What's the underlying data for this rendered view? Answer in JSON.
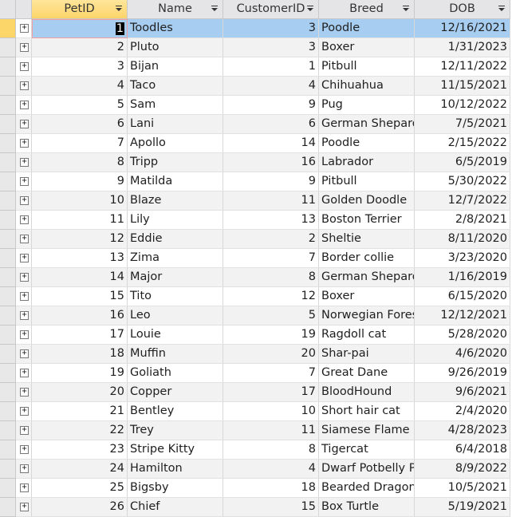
{
  "columns": [
    "PetID",
    "Name",
    "CustomerID",
    "Breed",
    "DOB"
  ],
  "rows": [
    [
      "1",
      "Toodles",
      "3",
      "Poodle",
      "12/16/2021"
    ],
    [
      "2",
      "Pluto",
      "3",
      "Boxer",
      "1/31/2023"
    ],
    [
      "3",
      "Bijan",
      "1",
      "Pitbull",
      "12/11/2022"
    ],
    [
      "4",
      "Taco",
      "4",
      "Chihuahua",
      "11/15/2021"
    ],
    [
      "5",
      "Sam",
      "9",
      "Pug",
      "10/12/2022"
    ],
    [
      "6",
      "Lani",
      "6",
      "German Shepard",
      "7/5/2021"
    ],
    [
      "7",
      "Apollo",
      "14",
      "Poodle",
      "2/15/2022"
    ],
    [
      "8",
      "Tripp",
      "16",
      "Labrador",
      "6/5/2019"
    ],
    [
      "9",
      "Matilda",
      "9",
      "Pitbull",
      "5/30/2022"
    ],
    [
      "10",
      "Blaze",
      "11",
      "Golden Doodle",
      "12/7/2022"
    ],
    [
      "11",
      "Lily",
      "13",
      "Boston Terrier",
      "2/8/2021"
    ],
    [
      "12",
      "Eddie",
      "2",
      "Sheltie",
      "8/11/2020"
    ],
    [
      "13",
      "Zima",
      "7",
      "Border collie",
      "3/23/2020"
    ],
    [
      "14",
      "Major",
      "8",
      "German Shepard",
      "1/16/2019"
    ],
    [
      "15",
      "Tito",
      "12",
      "Boxer",
      "6/15/2020"
    ],
    [
      "16",
      "Leo",
      "5",
      "Norwegian Forest",
      "12/12/2021"
    ],
    [
      "17",
      "Louie",
      "19",
      "Ragdoll cat",
      "5/28/2020"
    ],
    [
      "18",
      "Muffin",
      "20",
      "Shar-pai",
      "4/6/2020"
    ],
    [
      "19",
      "Goliath",
      "7",
      "Great Dane",
      "9/26/2019"
    ],
    [
      "20",
      "Copper",
      "17",
      "BloodHound",
      "9/6/2021"
    ],
    [
      "21",
      "Bentley",
      "10",
      "Short hair cat",
      "2/4/2020"
    ],
    [
      "22",
      "Trey",
      "11",
      "Siamese Flame Point",
      "4/28/2023"
    ],
    [
      "23",
      "Stripe Kitty",
      "8",
      "Tigercat",
      "6/4/2018"
    ],
    [
      "24",
      "Hamilton",
      "4",
      "Dwarf Potbelly Pig",
      "8/9/2022"
    ],
    [
      "25",
      "Bigsby",
      "18",
      "Bearded Dragon",
      "10/5/2021"
    ],
    [
      "26",
      "Chief",
      "15",
      "Box Turtle",
      "5/19/2021"
    ]
  ],
  "expand_symbol": "+"
}
